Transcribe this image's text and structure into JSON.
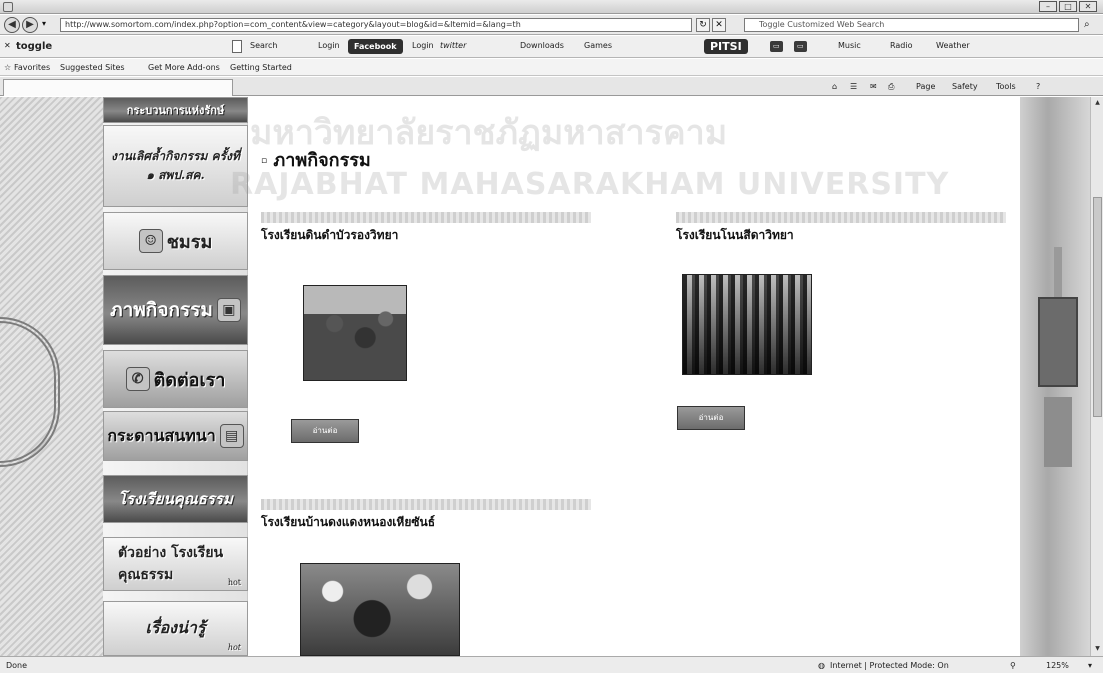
{
  "window": {
    "title": "",
    "buttons": [
      "–",
      "□",
      "✕"
    ]
  },
  "address": {
    "url": "http://www.somortom.com/index.php?option=com_content&view=category&layout=blog&id=&Itemid=&lang=th",
    "search_placeholder": "Toggle Customized Web Search"
  },
  "toolbar": {
    "toggle_label": "toggle",
    "search_label": "Search",
    "login_label": "Login",
    "facebook_label": "Facebook",
    "login2_label": "Login",
    "twitter_label": "twitter",
    "downloads_label": "Downloads",
    "games_label": "Games",
    "pitsi_label": "PITSI",
    "music_label": "Music",
    "radio_label": "Radio",
    "weather_label": "Weather"
  },
  "favorites": {
    "favorites_label": "Favorites",
    "suggested_label": "Suggested Sites",
    "addons_label": "Get More Add-ons",
    "getting_started_label": "Getting Started"
  },
  "tabbar": {
    "tab_title": "",
    "page_label": "Page",
    "safety_label": "Safety",
    "tools_label": "Tools"
  },
  "sidebar": {
    "items": [
      {
        "label": "กระบวนการแห่งรักษ์",
        "style": "dark"
      },
      {
        "label": "งานเลิศล้ำกิจกรรม ครั้งที่ ๑ สพป.สค.",
        "style": "light"
      },
      {
        "label": "ชมรม",
        "style": "light",
        "icon": "ghost-icon"
      },
      {
        "label": "ภาพกิจกรรม",
        "style": "dark",
        "icon": "photo-icon"
      },
      {
        "label": "ติดต่อเรา",
        "style": "mid",
        "icon": "phone-icon"
      },
      {
        "label": "กระดานสนทนา",
        "style": "mid",
        "icon": "board-icon"
      },
      {
        "label": "โรงเรียนคุณธรรม",
        "style": "dark"
      },
      {
        "label": "ตัวอย่าง โรงเรียนคุณธรรม",
        "style": "light",
        "badge": "hot"
      },
      {
        "label": "เรื่องน่ารู้",
        "style": "light",
        "badge": "hot"
      }
    ]
  },
  "main": {
    "heading": "ภาพกิจกรรม",
    "articles": [
      {
        "meta": "",
        "title": "โรงเรียนดินดำบัวรองวิทยา",
        "read_more": "อ่านต่อ"
      },
      {
        "meta": "",
        "title": "โรงเรียนโนนสีดาวิทยา",
        "read_more": "อ่านต่อ"
      },
      {
        "meta": "",
        "title": "โรงเรียนบ้านดงแดงหนองเหียซันธ์",
        "read_more": ""
      }
    ]
  },
  "watermark": {
    "thai": "มหาวิทยาลัยราชภัฏมหาสารคาม",
    "english": "RAJABHAT MAHASARAKHAM UNIVERSITY"
  },
  "status": {
    "left": "Done",
    "zone": "Internet | Protected Mode: On",
    "zoom": "125%"
  },
  "colors": {
    "menu_dark": "#5c5c5c",
    "menu_light": "#f4f4f4"
  }
}
